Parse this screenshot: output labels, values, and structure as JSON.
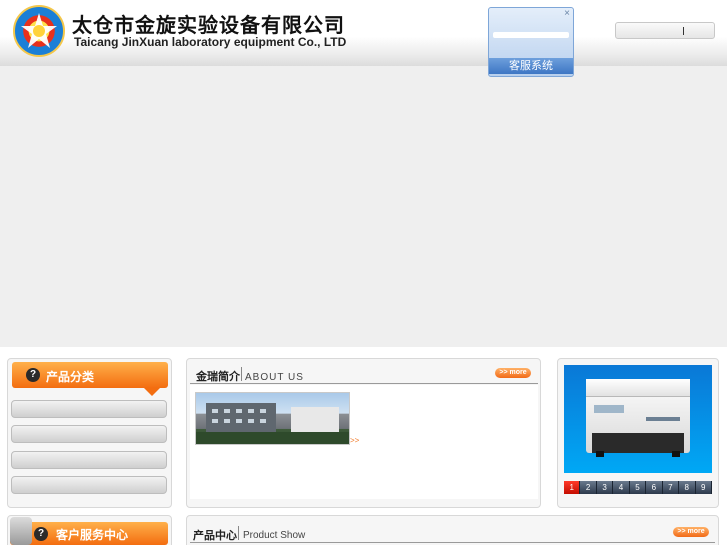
{
  "header": {
    "company_cn": "太仓市金旋实验设备有限公司",
    "company_en": "Taicang JinXuan laboratory equipment Co., LTD"
  },
  "customer_service": {
    "close_glyph": "×",
    "label": "客服系统"
  },
  "sidebar": {
    "category_title": "产品分类",
    "help_glyph": "?",
    "items": [
      "",
      "",
      "",
      ""
    ],
    "service_title": "客户服务中心"
  },
  "about": {
    "title_cn": "金瑞简介",
    "title_en": "ABOUT US",
    "more_label": ">> more",
    "arrows": ">>"
  },
  "products": {
    "title_cn": "产品中心",
    "title_en": "Product Show",
    "more_label": ">> more",
    "pager": [
      "1",
      "2",
      "3",
      "4",
      "5",
      "6",
      "7",
      "8",
      "9"
    ],
    "active_page": "1"
  },
  "colors": {
    "accent_orange": "#f36d10",
    "banner_gray": "#efefef",
    "cs_blue": "#3d76c4"
  }
}
